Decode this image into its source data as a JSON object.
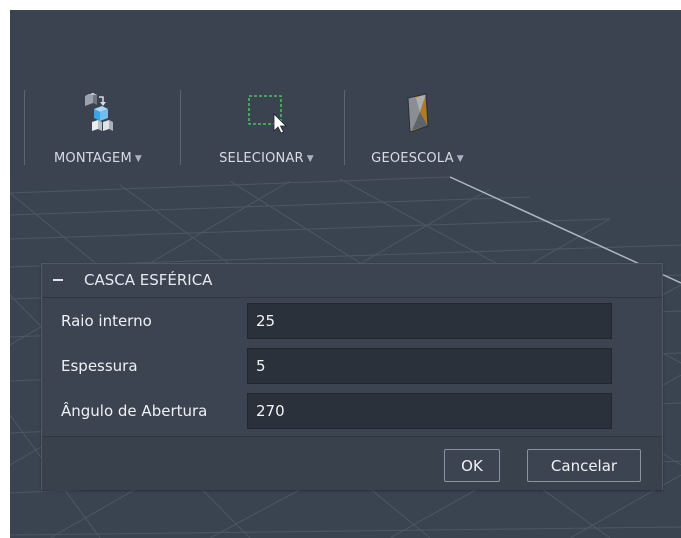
{
  "toolbar": {
    "items": [
      {
        "label": "MONTAGEM",
        "icon": "assembly-icon"
      },
      {
        "label": "SELECIONAR",
        "icon": "select-icon"
      },
      {
        "label": "GEOESCOLA",
        "icon": "geoescola-icon"
      }
    ]
  },
  "dialog": {
    "title": "CASCA ESFÉRICA",
    "fields": [
      {
        "label": "Raio interno",
        "value": "25"
      },
      {
        "label": "Espessura",
        "value": "5"
      },
      {
        "label": "Ângulo de Abertura",
        "value": "270"
      }
    ],
    "ok_label": "OK",
    "cancel_label": "Cancelar"
  },
  "colors": {
    "background": "#3a4350",
    "dialog": "#3b4450",
    "input": "#2a313a",
    "select_accent": "#4cd964"
  }
}
